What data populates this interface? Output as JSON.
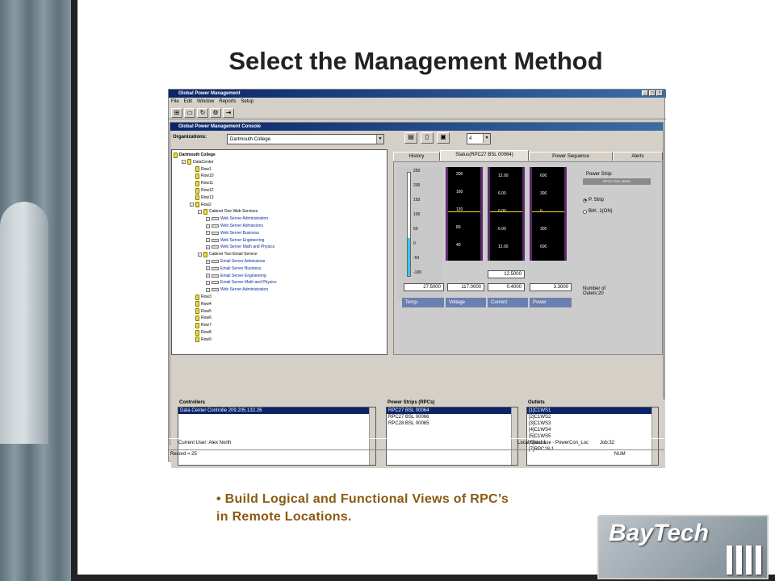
{
  "slide": {
    "title": "Select the Management Method",
    "bullet_line1": "Build Logical and Functional Views of RPC’s",
    "bullet_line2": "in Remote Locations.",
    "logo": "BayTech"
  },
  "app": {
    "title": "Global Power Management",
    "menu": [
      "File",
      "Edit",
      "Window",
      "Reports",
      "Setup"
    ],
    "console_title": "Global Power Management Console",
    "org_label": "Organizations:",
    "org_value": "Dartmouth College",
    "num_value": "4",
    "tree": [
      {
        "label": "Dartmouth College",
        "indent": 0,
        "blue": false
      },
      {
        "label": "DataCenter",
        "indent": 1,
        "blue": false
      },
      {
        "label": "Row1",
        "indent": 2,
        "blue": false
      },
      {
        "label": "Row10",
        "indent": 2,
        "blue": false
      },
      {
        "label": "Row11",
        "indent": 2,
        "blue": false
      },
      {
        "label": "Row12",
        "indent": 2,
        "blue": false
      },
      {
        "label": "Row13",
        "indent": 2,
        "blue": false
      },
      {
        "label": "Row2",
        "indent": 2,
        "blue": false
      },
      {
        "label": "Cabinet One Web Services",
        "indent": 3,
        "blue": false
      },
      {
        "label": "Web Server Administration",
        "indent": 4,
        "blue": true
      },
      {
        "label": "Web Server Admissions",
        "indent": 4,
        "blue": true
      },
      {
        "label": "Web Server Business",
        "indent": 4,
        "blue": true
      },
      {
        "label": "Web Server Engineering",
        "indent": 4,
        "blue": true
      },
      {
        "label": "Web Server Math and Physics",
        "indent": 4,
        "blue": true
      },
      {
        "label": "Cabinet Two Email Service",
        "indent": 3,
        "blue": false
      },
      {
        "label": "Email Server Admissions",
        "indent": 4,
        "blue": true
      },
      {
        "label": "Email Server Business",
        "indent": 4,
        "blue": true
      },
      {
        "label": "Email Server Engineering",
        "indent": 4,
        "blue": true
      },
      {
        "label": "Email Server Math and Physics",
        "indent": 4,
        "blue": true
      },
      {
        "label": "Web Server Administration",
        "indent": 4,
        "blue": true
      },
      {
        "label": "Row3",
        "indent": 2,
        "blue": false
      },
      {
        "label": "Row4",
        "indent": 2,
        "blue": false
      },
      {
        "label": "Row5",
        "indent": 2,
        "blue": false
      },
      {
        "label": "Row6",
        "indent": 2,
        "blue": false
      },
      {
        "label": "Row7",
        "indent": 2,
        "blue": false
      },
      {
        "label": "Row8",
        "indent": 2,
        "blue": false
      },
      {
        "label": "Row9",
        "indent": 2,
        "blue": false
      }
    ],
    "tabs": [
      "History",
      "Status(RPC27 BSL 00064)",
      "Power Sequence",
      "Alerts"
    ],
    "thermo": {
      "ticks": [
        "250",
        "200",
        "150",
        "100",
        "50",
        "0",
        "-50",
        "-100"
      ],
      "value": "27.5000",
      "label": "Temp."
    },
    "gauges": [
      {
        "label": "Voltage",
        "ticks": [
          "200",
          "160",
          "120",
          "80",
          "40"
        ],
        "value": "117.0000"
      },
      {
        "label": "Current",
        "ticks": [
          "12.00",
          "6.00",
          "0.00",
          "6.00",
          "12.00"
        ],
        "value": "0.4000",
        "top_value": "12.5000"
      },
      {
        "label": "Power",
        "ticks": [
          "600",
          "300",
          "0",
          "300",
          "600"
        ],
        "value": "3.3000"
      }
    ],
    "power_strip_label": "Power Strip:",
    "power_strip_value": "RPC27 BSL 00064",
    "radio_pstrip": "P. Strip",
    "radio_brk": "BrK. 1(ON)",
    "outlets_count_label": "Number of\nOulets:20",
    "controllers": {
      "label": "Controllers",
      "items": [
        "Data Center Controlle 209.205.132.26"
      ]
    },
    "power_strips": {
      "label": "Power Strips (RPCs)",
      "items": [
        "RPC27 BSL 00064",
        "RPC27 BSL 00066",
        "RPC28 BSL 00065"
      ]
    },
    "outlets": {
      "label": "Outlets",
      "items": [
        "[1]C1WS1",
        "[2]C1WS2",
        "[3]C1WS3",
        "[4]C1WS4",
        "[5]C1WS5",
        "[6]test 1",
        "[7]RPC18-1"
      ]
    },
    "status_user": "Current User: Alex North",
    "status_db": "Local Database - PowerCon_Loc",
    "status_job": "Job:32",
    "record": "Record = 25",
    "num": "NUM"
  }
}
